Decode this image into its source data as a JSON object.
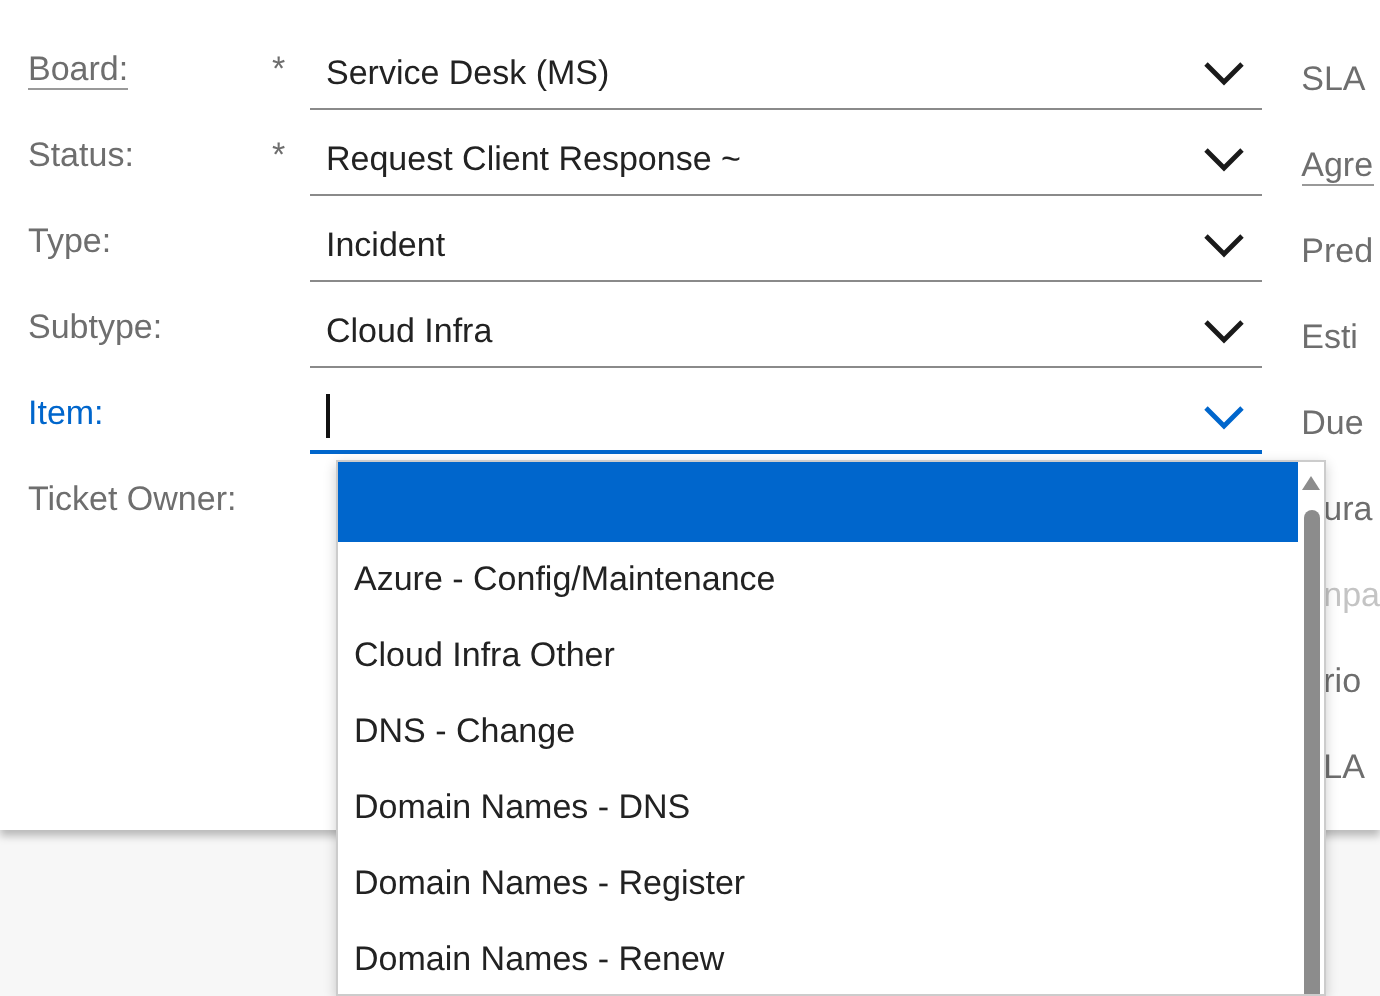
{
  "form": {
    "fields": [
      {
        "label": "Board:",
        "required_mark": "*",
        "underlined": true,
        "kind": "select",
        "value": "Service Desk (MS)",
        "focused": false
      },
      {
        "label": "Status:",
        "required_mark": "*",
        "underlined": false,
        "kind": "select",
        "value": "Request Client Response ~",
        "focused": false
      },
      {
        "label": "Type:",
        "underlined": false,
        "kind": "select",
        "value": "Incident",
        "focused": false
      },
      {
        "label": "Subtype:",
        "underlined": false,
        "kind": "select",
        "value": "Cloud Infra",
        "focused": false
      },
      {
        "label": "Item:",
        "underlined": false,
        "kind": "select",
        "focused": true
      },
      {
        "label": "Ticket Owner:",
        "underlined": false,
        "kind": "covered",
        "focused": false
      }
    ]
  },
  "side_labels": [
    {
      "text": "SLA",
      "kind": "full",
      "underlined": false,
      "disabled": false
    },
    {
      "text": "Agre",
      "kind": "full",
      "underlined": true,
      "disabled": false
    },
    {
      "text": "Pred",
      "kind": "full",
      "underlined": false,
      "disabled": false
    },
    {
      "text": "Esti",
      "kind": "full",
      "underlined": false,
      "disabled": false
    },
    {
      "text": "Due",
      "kind": "full",
      "underlined": false,
      "disabled": false
    },
    {
      "text": "ura",
      "kind": "partial",
      "underlined": false,
      "disabled": false
    },
    {
      "text": "npa",
      "kind": "partial",
      "underlined": false,
      "disabled": true
    },
    {
      "text": "rio",
      "kind": "partial",
      "underlined": false,
      "disabled": false
    },
    {
      "text": "LA",
      "kind": "partial",
      "underlined": false,
      "disabled": false
    }
  ],
  "dropdown": {
    "blank_option_selected": true,
    "options": [
      {
        "label": "Azure - Config/Maintenance",
        "selected": false
      },
      {
        "label": "Cloud Infra Other",
        "selected": false
      },
      {
        "label": "DNS - Change",
        "selected": false
      },
      {
        "label": "Domain Names - DNS",
        "selected": false
      },
      {
        "label": "Domain Names - Register",
        "selected": false
      },
      {
        "label": "Domain Names - Renew",
        "selected": false
      }
    ]
  }
}
